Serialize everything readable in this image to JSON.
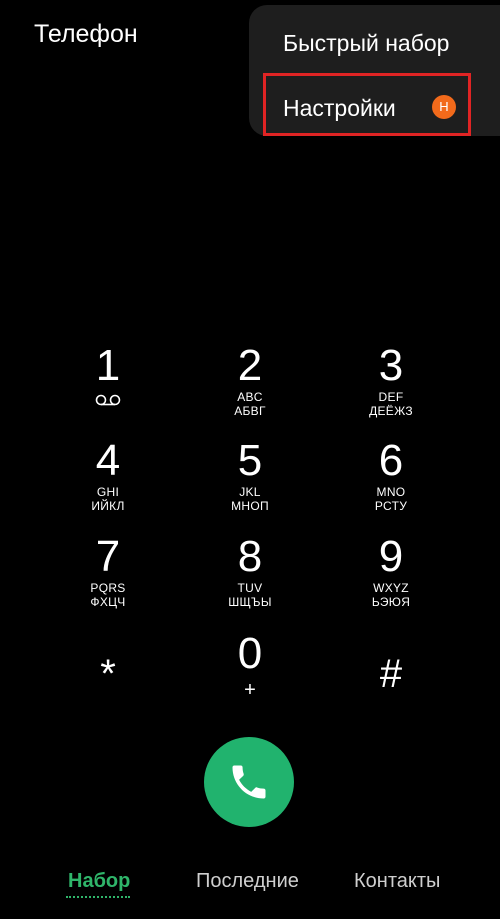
{
  "header": {
    "title": "Телефон"
  },
  "menu": {
    "items": [
      {
        "label": "Быстрый набор"
      },
      {
        "label": "Настройки",
        "badge": "Н"
      }
    ]
  },
  "keypad": {
    "keys": [
      {
        "digit": "1",
        "latin": "",
        "cyrillic": "",
        "icon": "voicemail-icon"
      },
      {
        "digit": "2",
        "latin": "ABC",
        "cyrillic": "АБВГ"
      },
      {
        "digit": "3",
        "latin": "DEF",
        "cyrillic": "ДЕЁЖЗ"
      },
      {
        "digit": "4",
        "latin": "GHI",
        "cyrillic": "ИЙКЛ"
      },
      {
        "digit": "5",
        "latin": "JKL",
        "cyrillic": "МНОП"
      },
      {
        "digit": "6",
        "latin": "MNO",
        "cyrillic": "РСТУ"
      },
      {
        "digit": "7",
        "latin": "PQRS",
        "cyrillic": "ФХЦЧ"
      },
      {
        "digit": "8",
        "latin": "TUV",
        "cyrillic": "ШЩЪЫ"
      },
      {
        "digit": "9",
        "latin": "WXYZ",
        "cyrillic": "ЬЭЮЯ"
      },
      {
        "digit": "*",
        "latin": "",
        "cyrillic": ""
      },
      {
        "digit": "0",
        "sub": "+"
      },
      {
        "digit": "#",
        "latin": "",
        "cyrillic": ""
      }
    ]
  },
  "call": {
    "icon": "phone-icon",
    "color": "#21b36e"
  },
  "tabs": [
    {
      "label": "Набор",
      "active": true
    },
    {
      "label": "Последние"
    },
    {
      "label": "Контакты"
    }
  ],
  "colors": {
    "accent": "#2fb56a",
    "badge": "#f26a1b",
    "highlight": "#e02424"
  }
}
